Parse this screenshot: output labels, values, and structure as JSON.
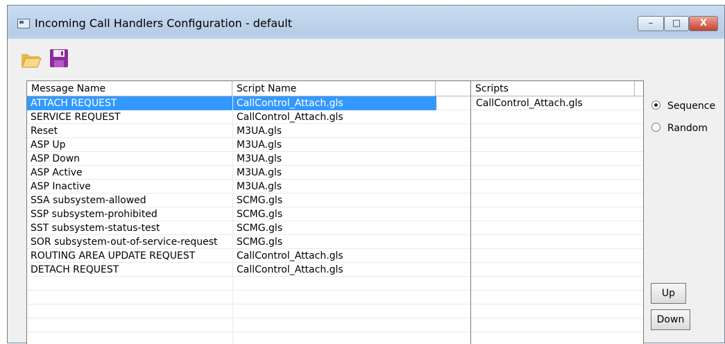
{
  "window": {
    "title": "Incoming Call Handlers Configuration - default",
    "controls": {
      "minimize": "–",
      "maximize": "□",
      "close": "X"
    }
  },
  "toolbar": {
    "icons": [
      "open-folder-icon",
      "save-disk-icon"
    ]
  },
  "message_table": {
    "columns": [
      "Message Name",
      "Script Name"
    ],
    "selected_index": 0,
    "rows": [
      {
        "message": "ATTACH REQUEST",
        "script": "CallControl_Attach.gls"
      },
      {
        "message": "SERVICE REQUEST",
        "script": "CallControl_Attach.gls"
      },
      {
        "message": "Reset",
        "script": "M3UA.gls"
      },
      {
        "message": "ASP Up",
        "script": "M3UA.gls"
      },
      {
        "message": "ASP Down",
        "script": "M3UA.gls"
      },
      {
        "message": "ASP Active",
        "script": "M3UA.gls"
      },
      {
        "message": "ASP Inactive",
        "script": "M3UA.gls"
      },
      {
        "message": "SSA subsystem-allowed",
        "script": "SCMG.gls"
      },
      {
        "message": "SSP subsystem-prohibited",
        "script": "SCMG.gls"
      },
      {
        "message": "SST subsystem-status-test",
        "script": "SCMG.gls"
      },
      {
        "message": "SOR subsystem-out-of-service-request",
        "script": "SCMG.gls"
      },
      {
        "message": "ROUTING AREA UPDATE REQUEST",
        "script": "CallControl_Attach.gls"
      },
      {
        "message": "DETACH REQUEST",
        "script": "CallControl_Attach.gls"
      }
    ]
  },
  "scripts_table": {
    "column": "Scripts",
    "rows": [
      "CallControl_Attach.gls"
    ]
  },
  "order": {
    "options": [
      "Sequence",
      "Random"
    ],
    "selected": "Sequence"
  },
  "buttons": {
    "up": "Up",
    "down": "Down"
  },
  "colors": {
    "selection": "#3399ff",
    "title_gradient": "#c9dcf0",
    "close_button": "#c6412c"
  }
}
